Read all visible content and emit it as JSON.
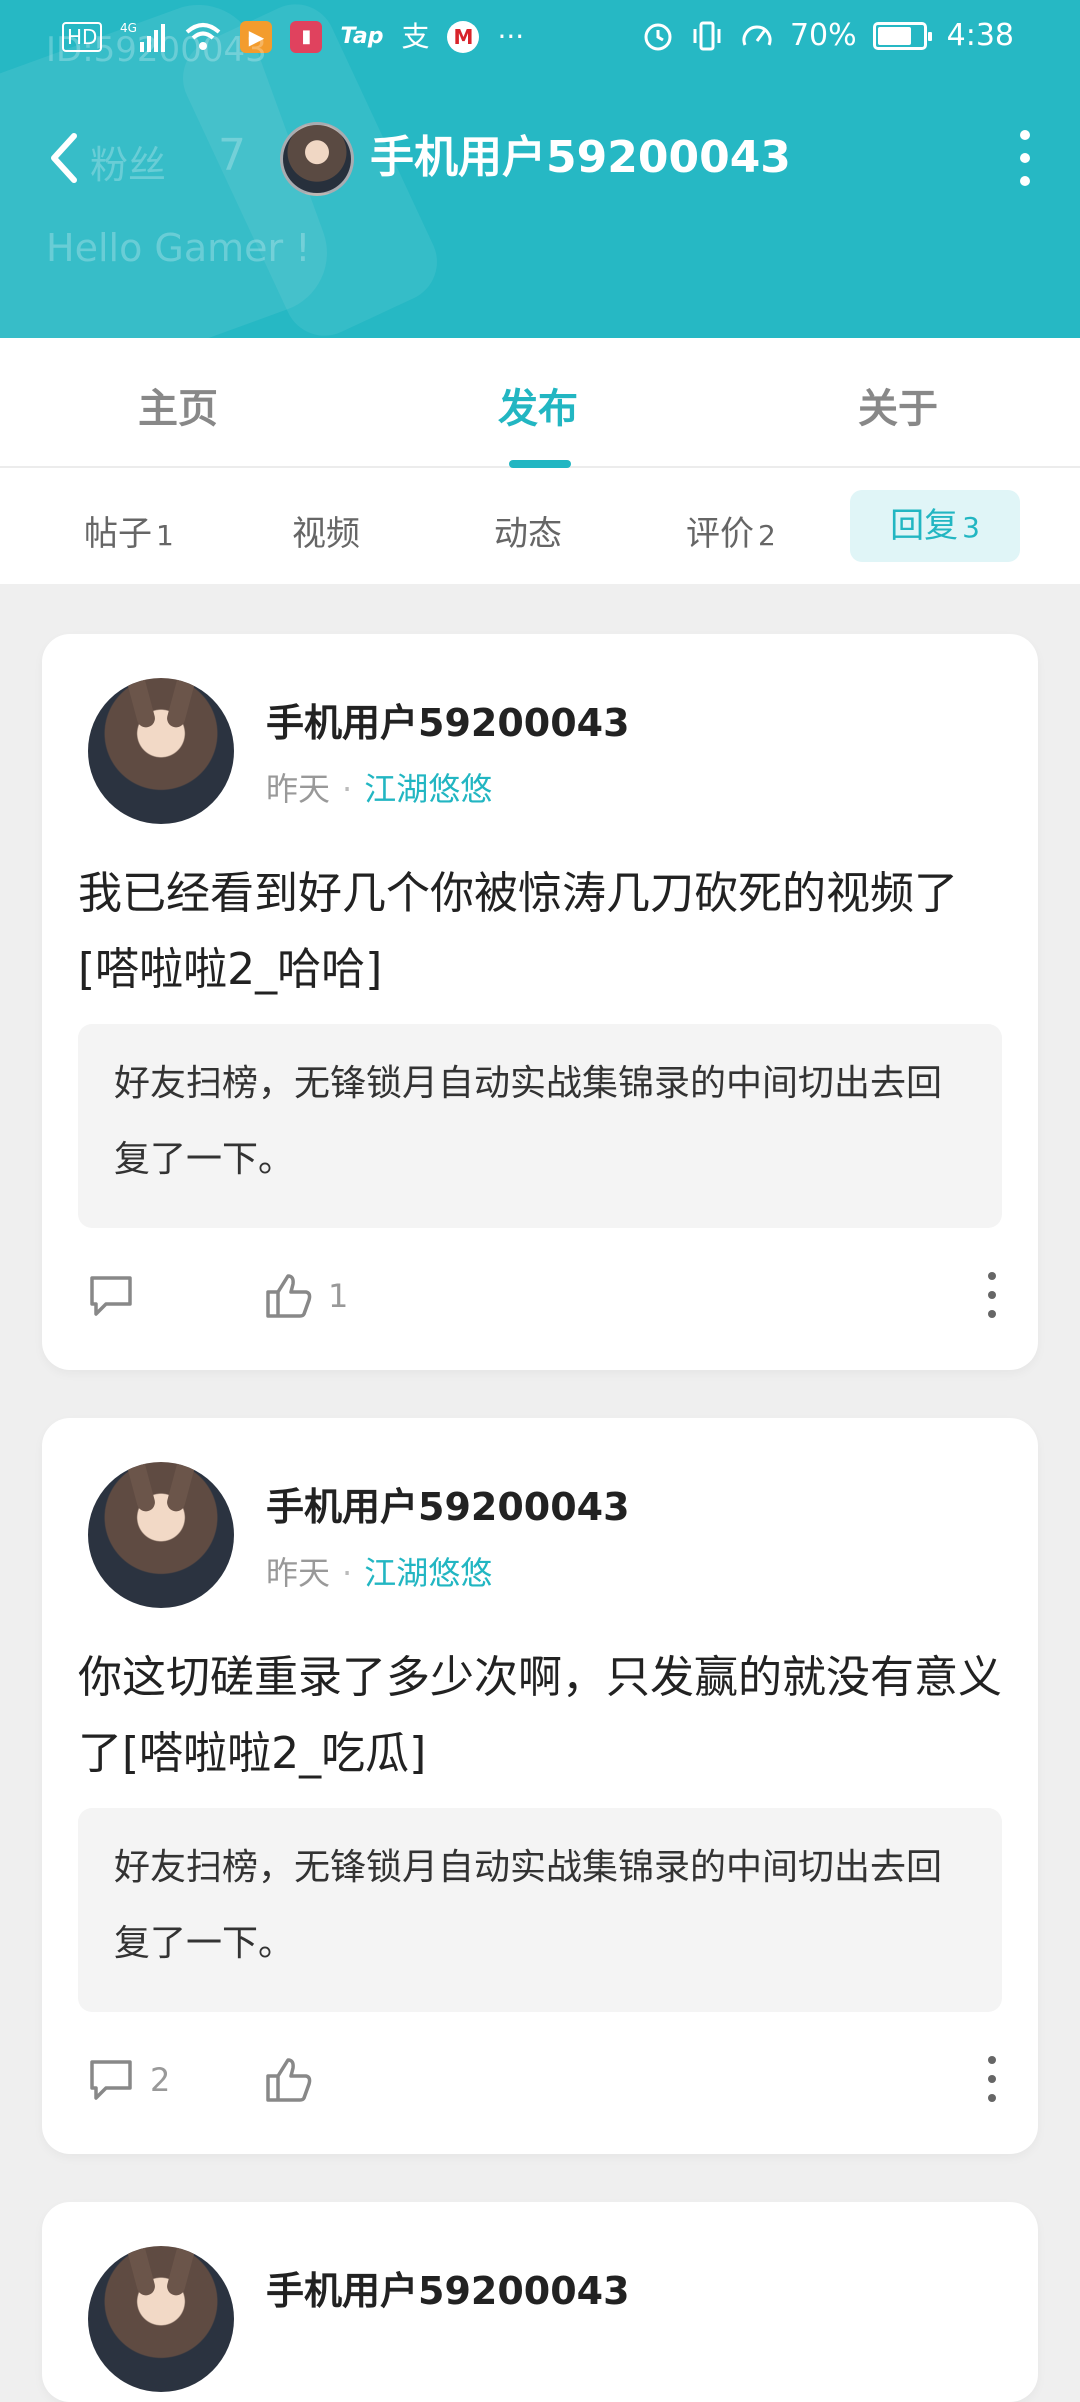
{
  "status_bar": {
    "left_icons": [
      "hd-icon",
      "4g-signal-icon",
      "wifi-icon",
      "video-app-icon",
      "book-app-icon",
      "taptap-icon",
      "alipay-icon",
      "bank-app-icon",
      "more-icon"
    ],
    "tap_label": "Tap",
    "zhi_label": "支",
    "ellipsis": "···",
    "battery": "70%",
    "time": "4:38"
  },
  "header": {
    "faded_id": "ID:59200043",
    "faded_fans": "粉丝",
    "faded_fans_count": "7",
    "faded_bio": "Hello Gamer !",
    "title": "手机用户59200043"
  },
  "tabs": [
    {
      "label": "主页",
      "active": false
    },
    {
      "label": "发布",
      "active": true
    },
    {
      "label": "关于",
      "active": false
    }
  ],
  "subtabs": [
    {
      "label": "帖子",
      "count": "1"
    },
    {
      "label": "视频",
      "count": ""
    },
    {
      "label": "动态",
      "count": ""
    },
    {
      "label": "评价",
      "count": "2"
    },
    {
      "label": "回复",
      "count": "3",
      "active": true
    }
  ],
  "posts": [
    {
      "user": "手机用户59200043",
      "time": "昨天",
      "circle": "江湖悠悠",
      "content": "我已经看到好几个你被惊涛几刀砍死的视频了[嗒啦啦2_哈哈]",
      "quote": "好友扫榜，无锋锁月自动实战集锦录的中间切出去回复了一下。",
      "comments": "",
      "likes": "1"
    },
    {
      "user": "手机用户59200043",
      "time": "昨天",
      "circle": "江湖悠悠",
      "content": "你这切磋重录了多少次啊，只发赢的就没有意义了[嗒啦啦2_吃瓜]",
      "quote": "好友扫榜，无锋锁月自动实战集锦录的中间切出去回复了一下。",
      "comments": "2",
      "likes": ""
    },
    {
      "user": "手机用户59200043"
    }
  ],
  "colors": {
    "accent": "#22b6c2",
    "header_bg": "#26b8c4"
  }
}
